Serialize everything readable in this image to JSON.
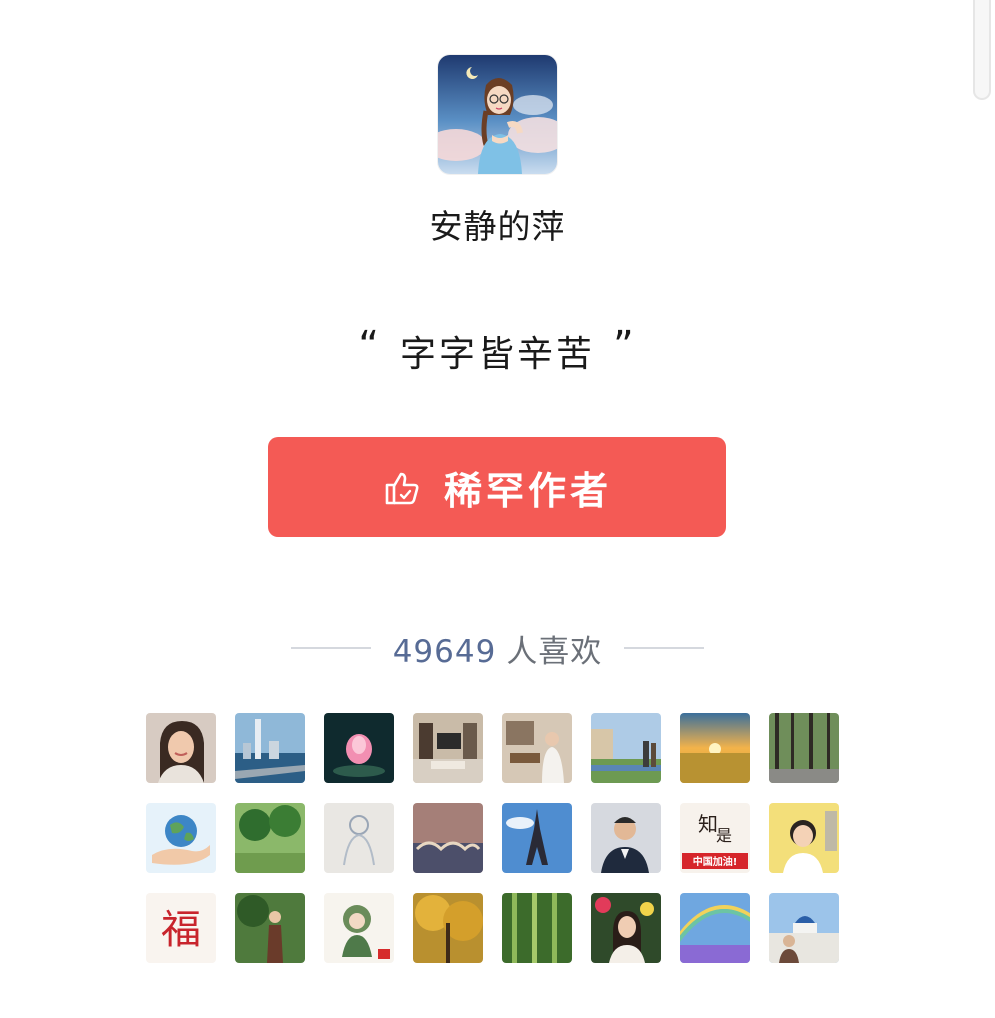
{
  "author": {
    "name": "安静的萍"
  },
  "quote": {
    "open": "“",
    "text": "字字皆辛苦",
    "close": "”"
  },
  "reward": {
    "label": "稀罕作者"
  },
  "likes": {
    "count": "49649",
    "unit": "人喜欢"
  },
  "colors": {
    "button": "#f45a55",
    "likes_count": "#576b95"
  },
  "avatars": [
    {
      "name": "avatar-woman-portrait",
      "label": ""
    },
    {
      "name": "avatar-city-seaside",
      "label": ""
    },
    {
      "name": "avatar-pink-lotus",
      "label": ""
    },
    {
      "name": "avatar-living-room",
      "label": ""
    },
    {
      "name": "avatar-person-indoor",
      "label": ""
    },
    {
      "name": "avatar-riverside-people",
      "label": ""
    },
    {
      "name": "avatar-sunset-field",
      "label": ""
    },
    {
      "name": "avatar-forest-trees",
      "label": ""
    },
    {
      "name": "avatar-earth-in-hand",
      "label": ""
    },
    {
      "name": "avatar-green-trees",
      "label": ""
    },
    {
      "name": "avatar-white-sketch",
      "label": ""
    },
    {
      "name": "avatar-night-bridge",
      "label": ""
    },
    {
      "name": "avatar-eiffel-tower",
      "label": ""
    },
    {
      "name": "avatar-man-suit",
      "label": ""
    },
    {
      "name": "avatar-china-jiayou",
      "label": "中国加油!"
    },
    {
      "name": "avatar-child-photo",
      "label": ""
    },
    {
      "name": "avatar-fu-calligraphy",
      "label": "福"
    },
    {
      "name": "avatar-garden-person",
      "label": ""
    },
    {
      "name": "avatar-opera-figure",
      "label": ""
    },
    {
      "name": "avatar-ginkgo-tree",
      "label": ""
    },
    {
      "name": "avatar-bamboo-forest",
      "label": ""
    },
    {
      "name": "avatar-woman-flowers",
      "label": ""
    },
    {
      "name": "avatar-rainbow-field",
      "label": ""
    },
    {
      "name": "avatar-santorini",
      "label": ""
    }
  ]
}
